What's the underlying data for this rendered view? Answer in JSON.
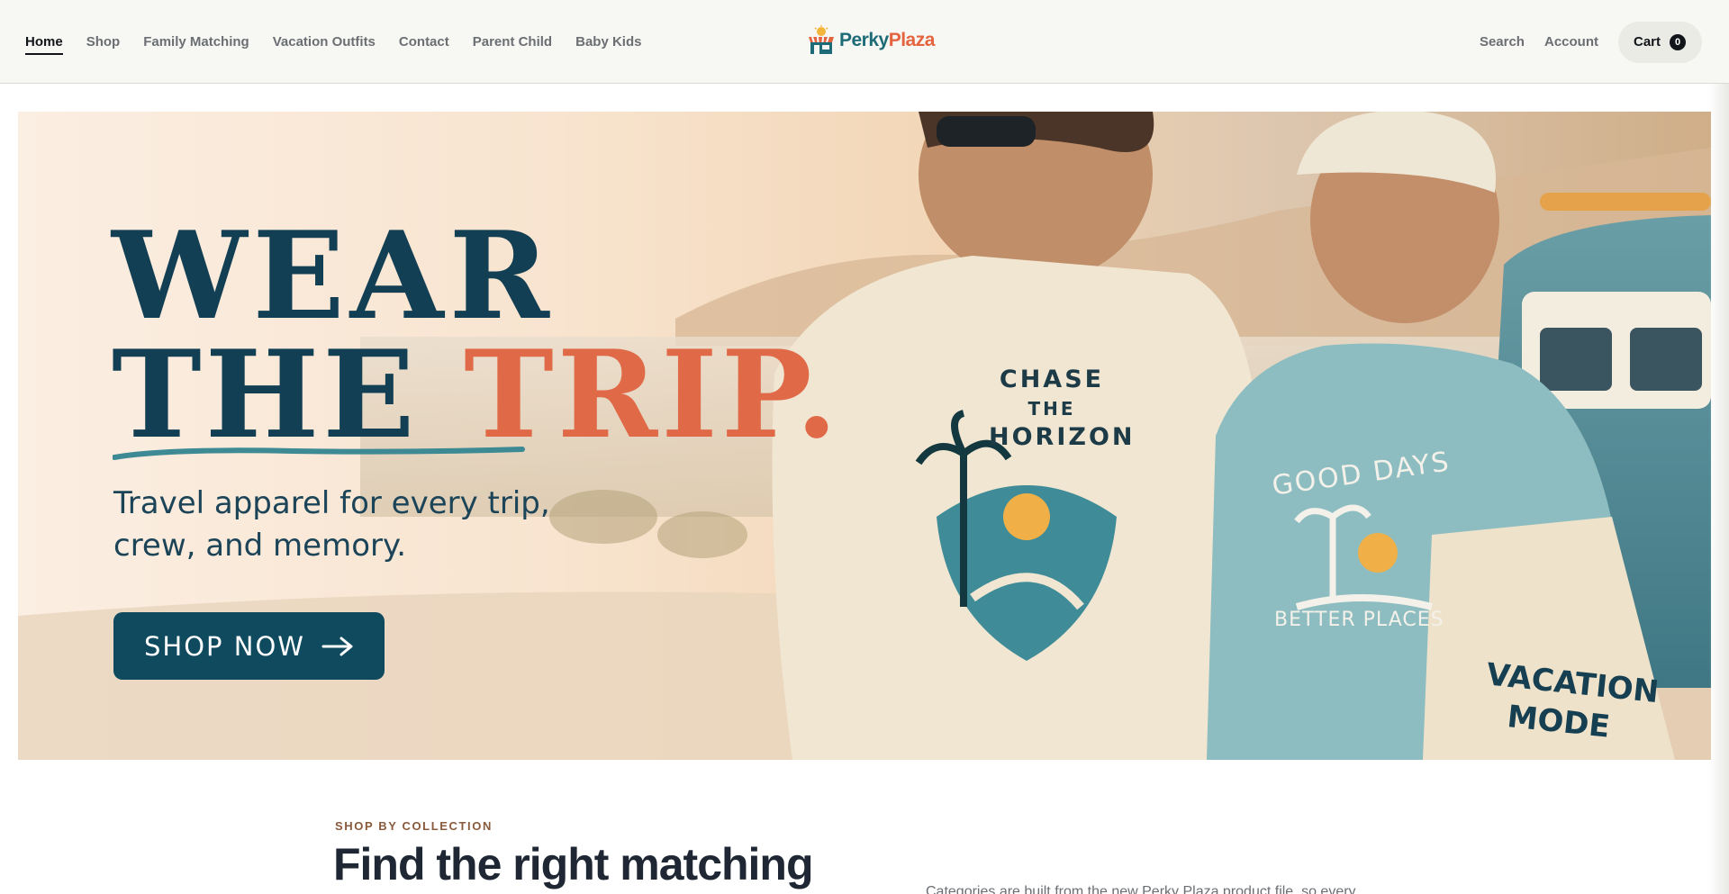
{
  "header": {
    "nav": [
      {
        "label": "Home",
        "active": true
      },
      {
        "label": "Shop"
      },
      {
        "label": "Family Matching"
      },
      {
        "label": "Vacation Outfits"
      },
      {
        "label": "Contact"
      },
      {
        "label": "Parent Child"
      },
      {
        "label": "Baby Kids"
      }
    ],
    "logo": {
      "part1": "Perky",
      "part2": "Plaza"
    },
    "search_label": "Search",
    "account_label": "Account",
    "cart_label": "Cart",
    "cart_count": "0"
  },
  "hero": {
    "headline_line1": "WEAR",
    "headline_line2_a": "THE ",
    "headline_line2_b": "TRIP.",
    "subtitle_line1": "Travel apparel for every trip,",
    "subtitle_line2": "crew, and memory.",
    "cta_label": "SHOP NOW",
    "cta_icon": "arrow-right-icon",
    "tee_text_1": "CHASE",
    "tee_text_2": "THE",
    "tee_text_3": "HORIZON",
    "sweater_text_1": "GOOD DAYS",
    "sweater_text_2": "BETTER PLACES",
    "tote_text_1": "VACATION",
    "tote_text_2": "MODE"
  },
  "collections": {
    "eyebrow": "SHOP BY COLLECTION",
    "title": "Find the right matching",
    "description": "Categories are built from the new Perky Plaza product file, so every"
  },
  "colors": {
    "brand_teal": "#0f4a5e",
    "accent_coral": "#e06a48",
    "header_bg": "#f7f7f3"
  }
}
